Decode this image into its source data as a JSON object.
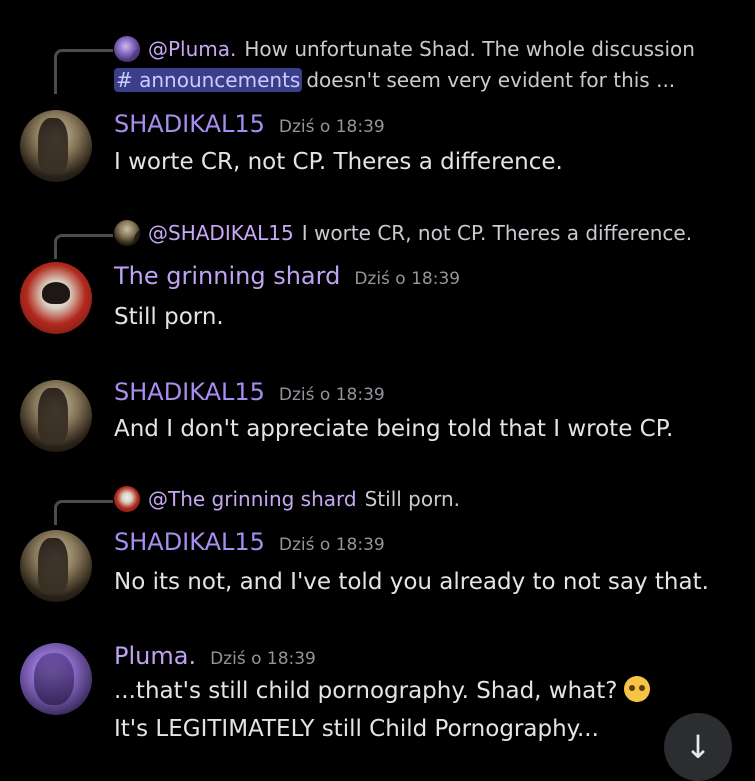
{
  "messages": [
    {
      "reply": {
        "name": "@Pluma.",
        "text": "How unfortunate Shad. The whole discussion",
        "mention": "# announcements",
        "text2": "doesn't seem very evident for this ..."
      },
      "author": "SHADIKAL15",
      "timestamp": "Dziś o 18:39",
      "text": "I worte CR, not CP. Theres a difference."
    },
    {
      "reply": {
        "name": "@SHADIKAL15",
        "text": "I worte CR, not CP. Theres a difference."
      },
      "author": "The grinning shard",
      "timestamp": "Dziś o 18:39",
      "text": "Still porn."
    },
    {
      "author": "SHADIKAL15",
      "timestamp": "Dziś o 18:39",
      "text": "And I don't appreciate being told that I wrote CP."
    },
    {
      "reply": {
        "name": "@The grinning shard",
        "text": "Still porn."
      },
      "author": "SHADIKAL15",
      "timestamp": "Dziś o 18:39",
      "text": "No its not, and I've told you already to not say that."
    },
    {
      "author": "Pluma.",
      "timestamp": "Dziś o 18:39",
      "text": "...that's still child pornography. Shad, what?",
      "text2": "It's LEGITIMATELY still Child Pornography..."
    }
  ],
  "icons": {
    "scroll_down": "arrow-down-icon",
    "emoji": "loudly-crying-face-emoji"
  },
  "scroll_label": "↓"
}
